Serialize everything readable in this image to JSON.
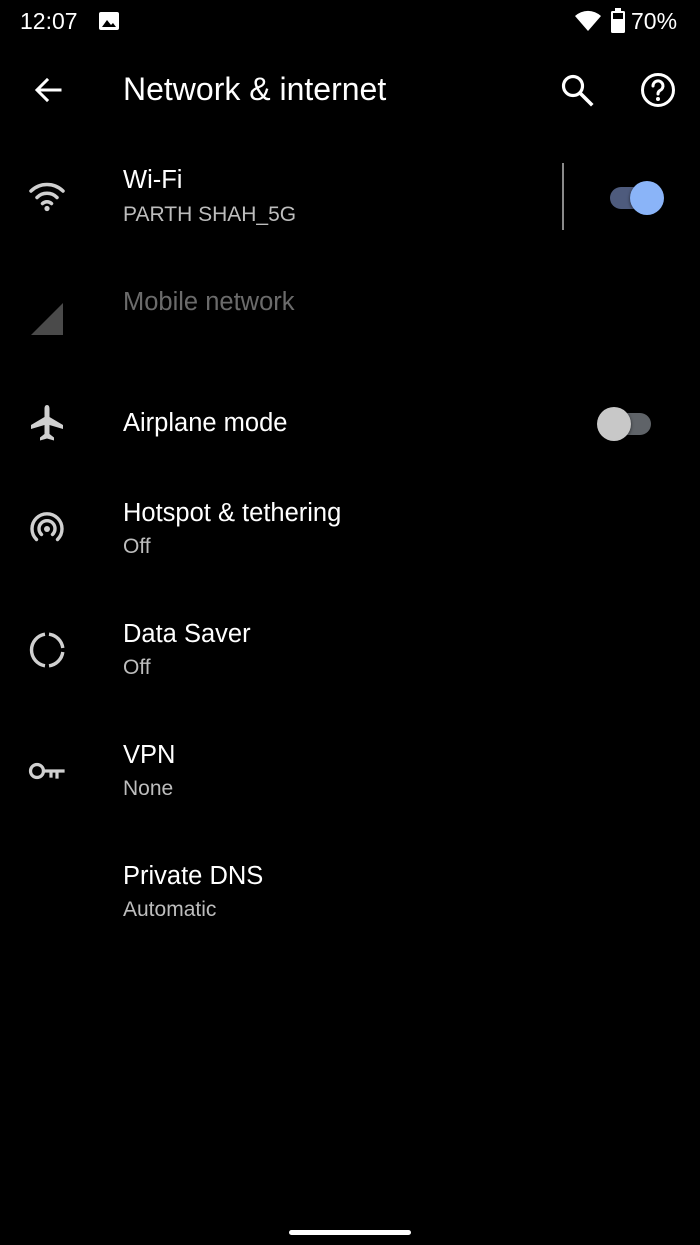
{
  "status_bar": {
    "time": "12:07",
    "battery": "70%"
  },
  "app_bar": {
    "title": "Network & internet"
  },
  "items": [
    {
      "title": "Wi-Fi",
      "summary": "PARTH SHAH_5G",
      "icon": "wifi-icon",
      "switch": "on"
    },
    {
      "title": "Mobile network",
      "summary": "",
      "icon": "signal-icon",
      "disabled": true
    },
    {
      "title": "Airplane mode",
      "summary": "",
      "icon": "airplane-icon",
      "switch": "off"
    },
    {
      "title": "Hotspot & tethering",
      "summary": "Off",
      "icon": "hotspot-icon"
    },
    {
      "title": "Data Saver",
      "summary": "Off",
      "icon": "data-saver-icon"
    },
    {
      "title": "VPN",
      "summary": "None",
      "icon": "key-icon"
    },
    {
      "title": "Private DNS",
      "summary": "Automatic",
      "icon": ""
    }
  ],
  "colors": {
    "background": "#000000",
    "accent": "#8ab4f8",
    "secondary_text": "#bdbdbd",
    "disabled_text": "#6b6b6b"
  }
}
